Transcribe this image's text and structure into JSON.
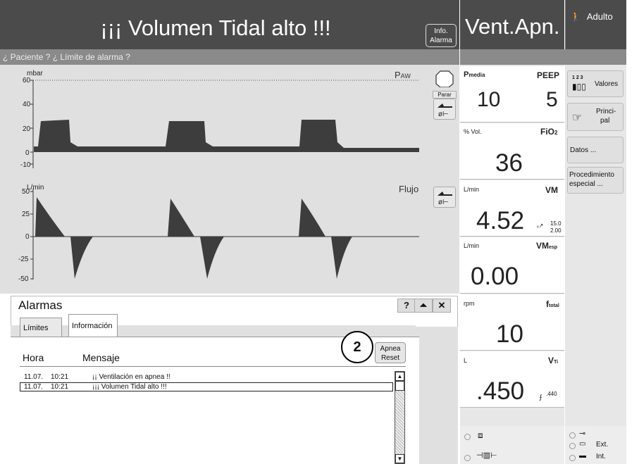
{
  "header": {
    "alarm_title": "¡¡¡ Volumen Tidal alto !!!",
    "info_alarm_btn": [
      "Info.",
      "Alarma"
    ],
    "subtitle": "¿ Paciente ? ¿ Límite de alarma ?",
    "mode": "Vent.Apn.",
    "patient_type": "Adulto"
  },
  "waveforms": {
    "pressure": {
      "unit": "mbar",
      "name": "PAW",
      "ticks": [
        "60",
        "40",
        "20",
        "0",
        "-10"
      ],
      "stop_label": "Parar"
    },
    "flow": {
      "unit": "L/min",
      "name": "Flujo",
      "ticks": [
        "50",
        "25",
        "0",
        "-25",
        "-50"
      ]
    }
  },
  "alarm_panel": {
    "title": "Alarmas",
    "help_btn": "?",
    "collapse_btn": "⏶",
    "close_btn": "✕",
    "tabs": [
      "Límites",
      "Información"
    ],
    "active_tab": "Información",
    "col_hora": "Hora",
    "col_mensaje": "Mensaje",
    "apnea_reset": [
      "Apnea",
      "Reset"
    ],
    "callout": "2",
    "log": [
      {
        "date": "11.07.",
        "time": "10:21",
        "msg": "¡¡ Ventilación en apnea !!"
      },
      {
        "date": "11.07.",
        "time": "10:21",
        "msg": "¡¡¡ Volumen Tidal alto !!!"
      }
    ]
  },
  "parameters": {
    "pmedia_label": "Pmedia",
    "pmedia_value": "10",
    "peep_label": "PEEP",
    "peep_value": "5",
    "fio2_unit": "% Vol.",
    "fio2_label": "FiO2",
    "fio2_value": "36",
    "vm_unit": "L/min",
    "vm_label": "VM",
    "vm_value": "4.52",
    "vm_high": "15.0",
    "vm_low": "2.00",
    "vmesp_unit": "L/min",
    "vmesp_label": "VMesp",
    "vmesp_value": "0.00",
    "ftotal_unit": "rpm",
    "ftotal_label": "ftotal",
    "ftotal_value": "10",
    "vti_unit": "L",
    "vti_label": "VTi",
    "vti_value": ".450",
    "vti_limit": ".440"
  },
  "right_menu": {
    "valores": "Valores",
    "valores_nums": "1 2 3",
    "principal": [
      "Princi-",
      "pal"
    ],
    "datos": "Datos ...",
    "procedimiento": [
      "Procedimiento",
      "especial ..."
    ]
  },
  "bottom": {
    "ext_label": "Ext.",
    "int_label": "Int."
  },
  "colors": {
    "dark_header": "#4b4b4b",
    "subheader": "#8a8a8a",
    "wave_fill": "#3d3d3d",
    "panel_bg": "#e0e0e0"
  }
}
